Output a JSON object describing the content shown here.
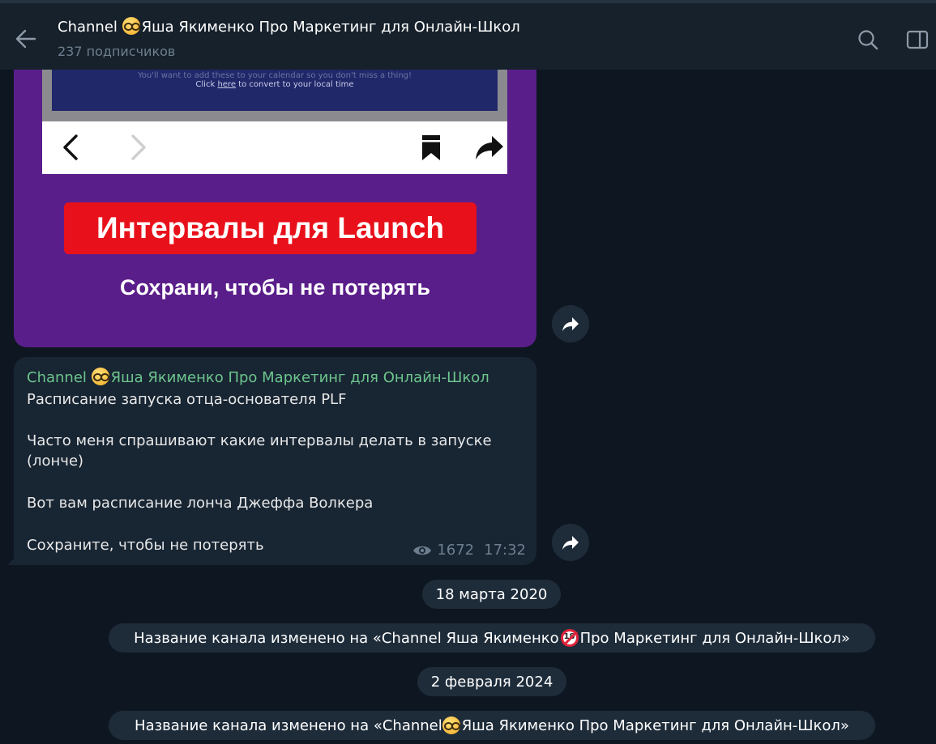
{
  "header": {
    "title_prefix": "Channel ",
    "title_rest": "Яша Якименко Про Маркетинг для Онлайн-Школ",
    "subtitle": "237 подписчиков"
  },
  "image_post": {
    "phone_note_line1": "You'll want to add these to your calendar so you don't miss a thing!",
    "phone_note_click": "Click ",
    "phone_note_here": "here",
    "phone_note_rest": " to convert to your local time",
    "badge_text": "Интервалы для Launch",
    "caption_text": "Сохрани, чтобы не потерять"
  },
  "text_post": {
    "sender_prefix": "Channel ",
    "sender_rest": "Яша Якименко Про Маркетинг для Онлайн-Школ",
    "lines": [
      "Расписание запуска отца-основателя PLF",
      "Часто меня спрашивают какие интервалы делать в запуске",
      "(лонче)",
      "Вот вам расписание лонча Джеффа Волкера",
      "Сохраните, чтобы не потерять"
    ],
    "views": "1672",
    "time": "17:32"
  },
  "date_1": "18 марта 2020",
  "service_1": {
    "before": "Название канала изменено на «Channel Яша Якименко ",
    "emoji_text": "18",
    "after": "Про Маркетинг для Онлайн-Школ»"
  },
  "date_2": "2 февраля 2024",
  "service_2": {
    "before": "Название канала изменено на «Channel ",
    "after": "Яша Якименко Про Маркетинг для Онлайн-Школ»"
  },
  "colors": {
    "background": "#0e1621",
    "header": "#17212b",
    "bubble": "#182533",
    "sender": "#6dc58d",
    "badge_red": "#e8111b",
    "image_purple": "#5a1e8a"
  }
}
